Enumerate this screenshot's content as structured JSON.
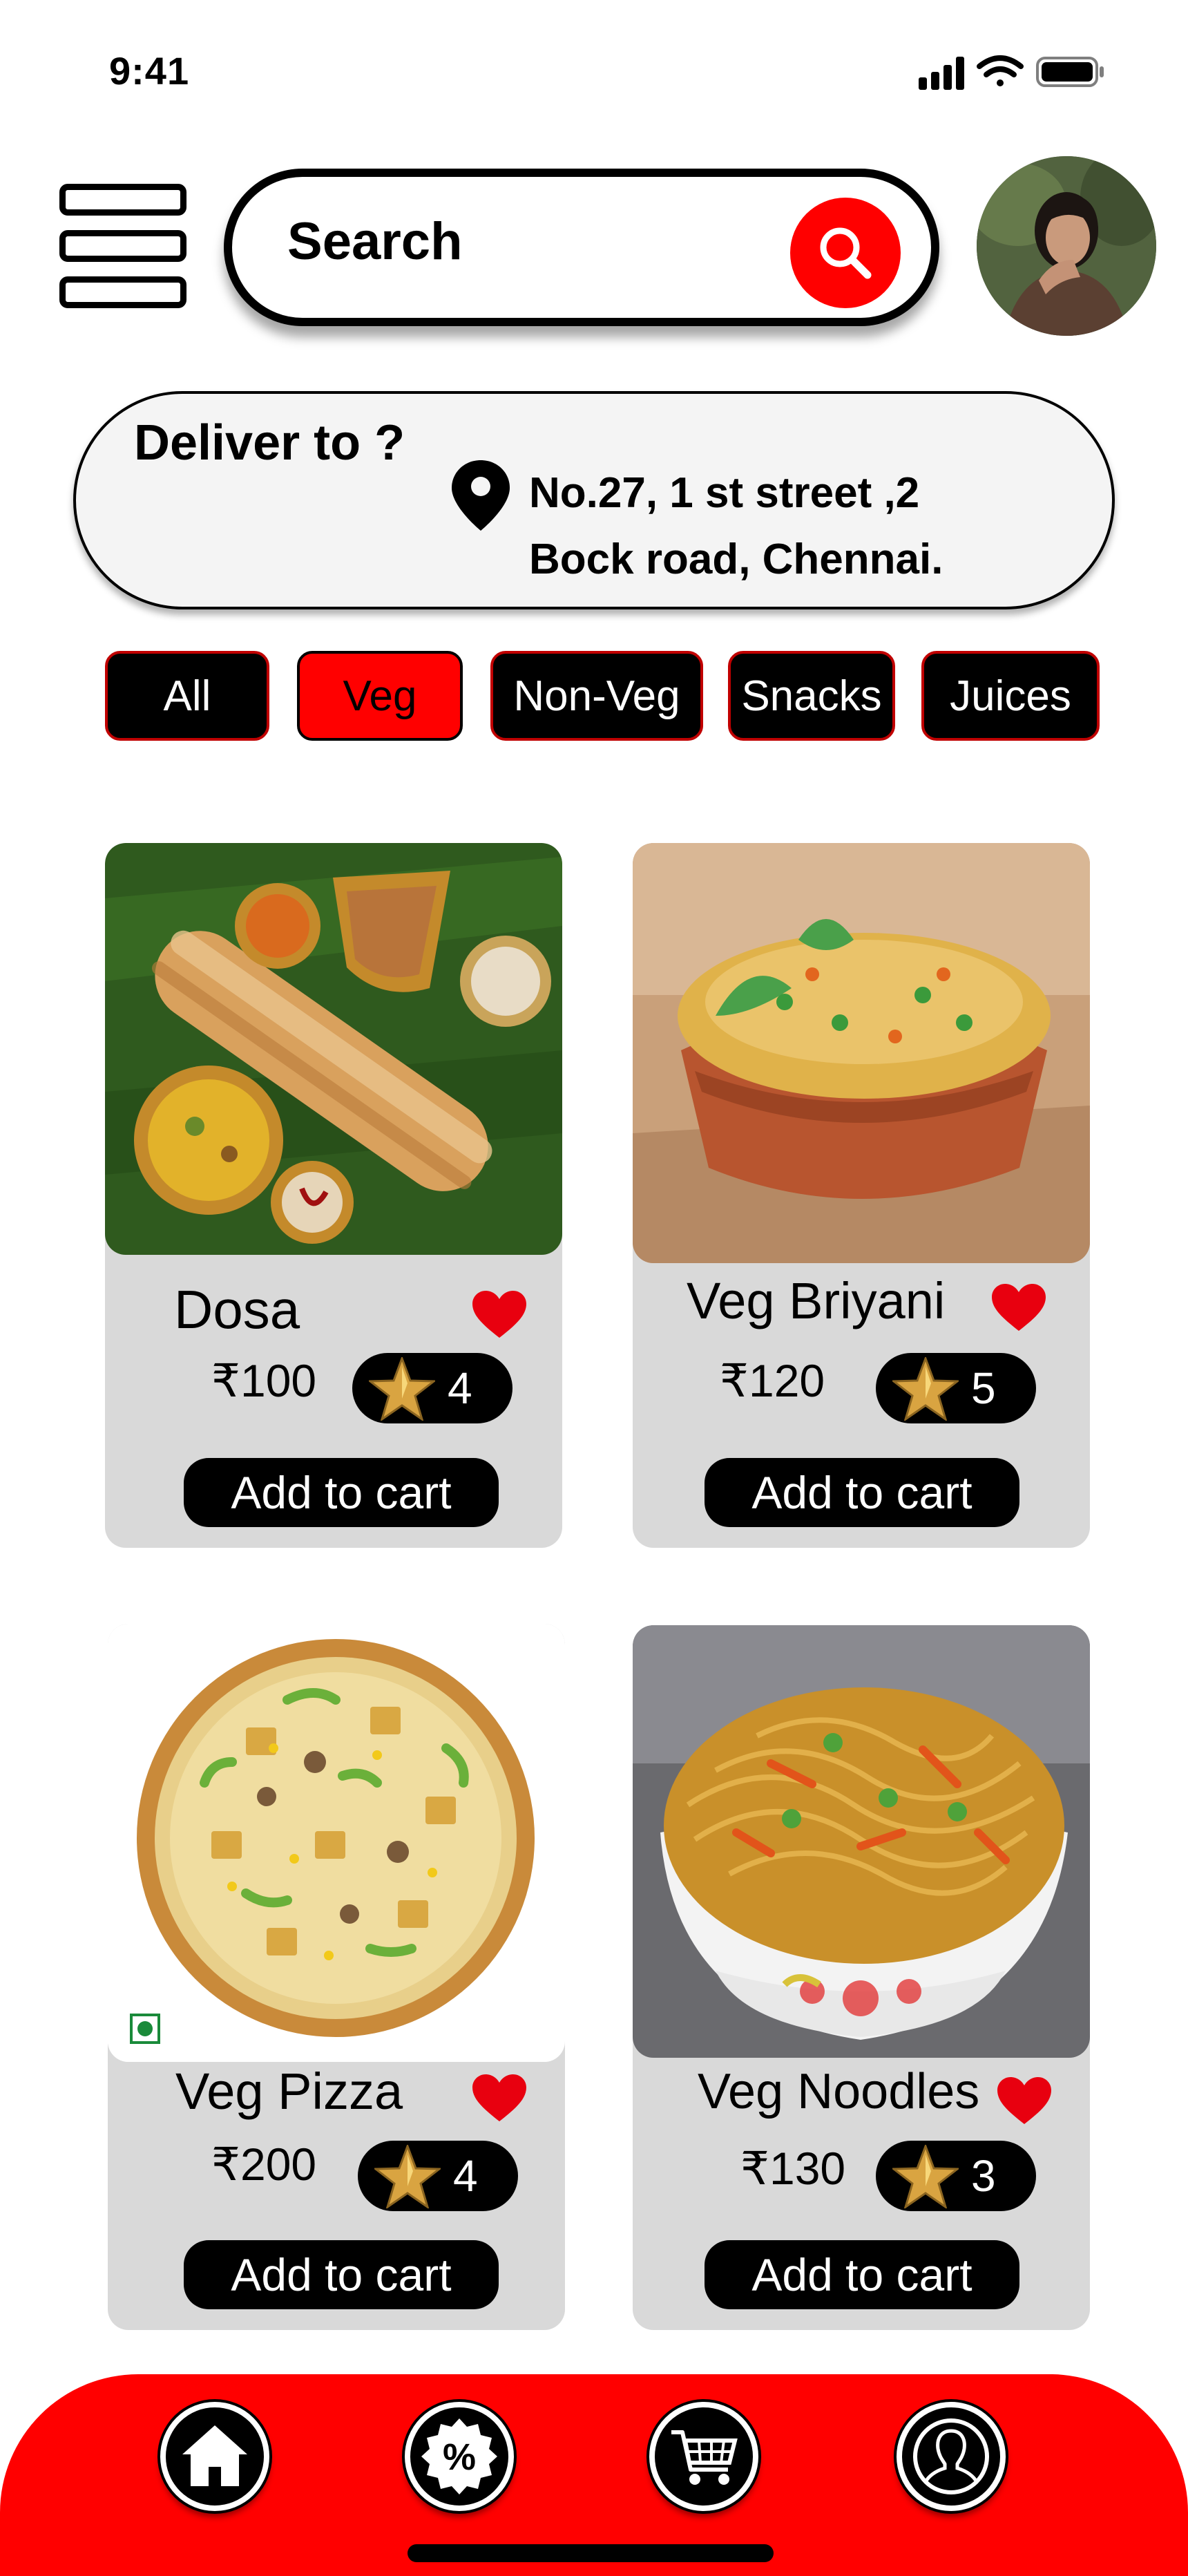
{
  "status_bar": {
    "time": "9:41"
  },
  "header": {
    "search_label": "Search"
  },
  "delivery": {
    "title": "Deliver to ?",
    "address_line1": "No.27, 1 st street ,2",
    "address_line2": "Bock road, Chennai."
  },
  "categories": [
    {
      "label": "All",
      "active": false
    },
    {
      "label": "Veg",
      "active": true
    },
    {
      "label": "Non-Veg",
      "active": false
    },
    {
      "label": "Snacks",
      "active": false
    },
    {
      "label": "Juices",
      "active": false
    }
  ],
  "products": [
    {
      "name": "Dosa",
      "price": "₹100",
      "rating": "4",
      "cart_label": "Add to cart"
    },
    {
      "name": "Veg Briyani",
      "price": "₹120",
      "rating": "5",
      "cart_label": "Add to cart"
    },
    {
      "name": "Veg Pizza",
      "price": "₹200",
      "rating": "4",
      "cart_label": "Add to cart"
    },
    {
      "name": "Veg Noodles",
      "price": "₹130",
      "rating": "3",
      "cart_label": "Add to cart"
    }
  ],
  "bottom_nav": {
    "items": [
      "home-icon",
      "discount-icon",
      "cart-icon",
      "profile-icon"
    ]
  },
  "colors": {
    "accent": "#ff0000",
    "card_bg": "#d9d9d9",
    "heart": "#e8000f"
  }
}
